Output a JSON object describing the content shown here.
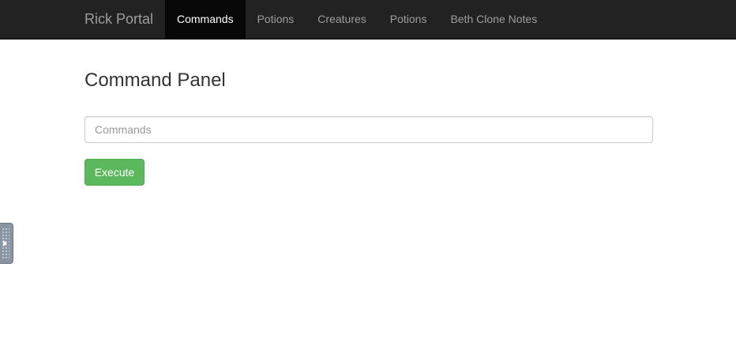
{
  "navbar": {
    "brand": "Rick Portal",
    "items": [
      {
        "label": "Commands",
        "active": true
      },
      {
        "label": "Potions",
        "active": false
      },
      {
        "label": "Creatures",
        "active": false
      },
      {
        "label": "Potions",
        "active": false
      },
      {
        "label": "Beth Clone Notes",
        "active": false
      }
    ]
  },
  "main": {
    "title": "Command Panel",
    "command_input": {
      "placeholder": "Commands",
      "value": ""
    },
    "execute_label": "Execute"
  },
  "side_panel": {
    "icon": "expand-arrow-icon"
  },
  "colors": {
    "navbar_bg": "#222222",
    "active_tab_bg": "#080808",
    "button_green": "#5cb85c"
  }
}
